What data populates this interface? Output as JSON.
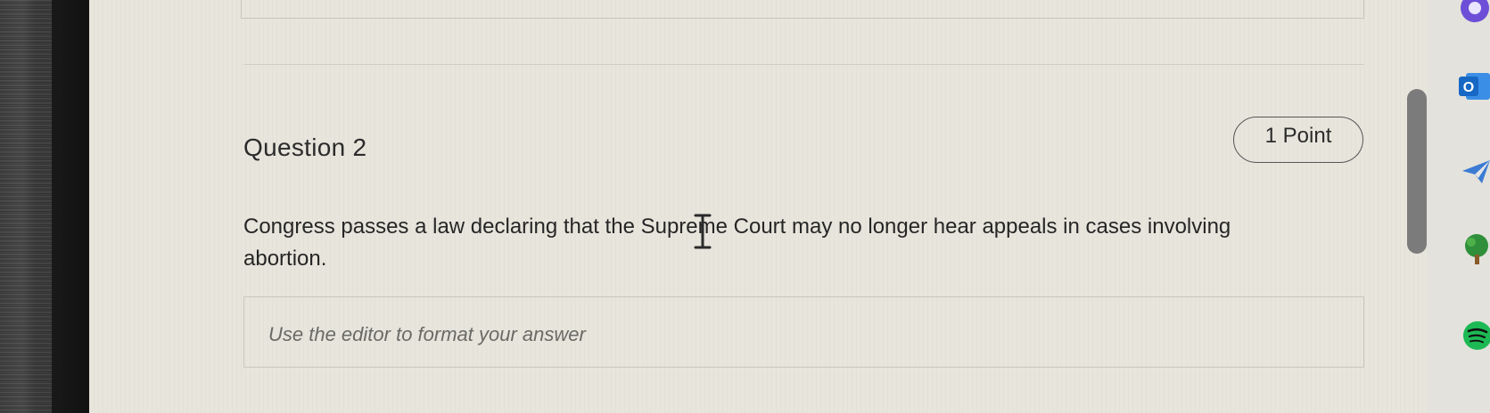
{
  "question": {
    "title": "Question 2",
    "points": "1 Point",
    "text": "Congress passes a law declaring that the Supreme Court may no longer hear appeals in cases involving abortion."
  },
  "answer_editor": {
    "placeholder": "Use the editor to format your answer"
  },
  "dock": {
    "icons": [
      "app-icon-purple",
      "outlook-icon",
      "paper-plane-icon",
      "tree-icon",
      "spotify-icon"
    ]
  },
  "colors": {
    "screen_background": "#e7e5dc",
    "text": "#262626",
    "placeholder": "#6a6a66",
    "scrollbar": "#7b7b7b",
    "outlook_blue": "#1768c4",
    "spotify_green": "#1db954"
  }
}
